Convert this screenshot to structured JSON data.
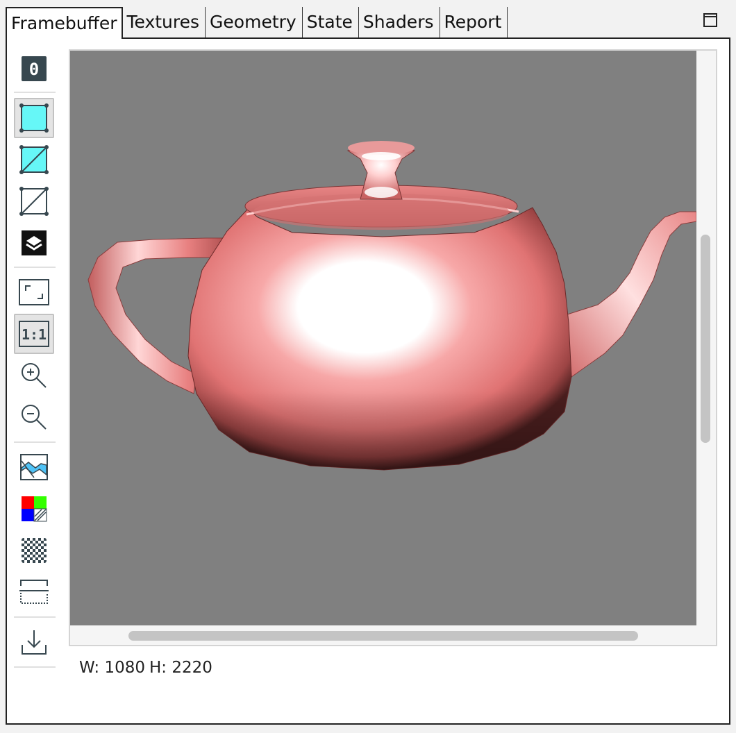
{
  "tabs": [
    {
      "label": "Framebuffer",
      "active": true
    },
    {
      "label": "Textures"
    },
    {
      "label": "Geometry"
    },
    {
      "label": "State"
    },
    {
      "label": "Shaders"
    },
    {
      "label": "Report"
    }
  ],
  "toolbar": {
    "attachment_label": "0",
    "zoom_actual_label": "1:1",
    "buttons": [
      {
        "icon": "attachment-index-icon",
        "label": "0"
      },
      {
        "icon": "render-rect-icon",
        "pressed": true
      },
      {
        "icon": "render-shaded-wireframe-icon"
      },
      {
        "icon": "render-wireframe-icon"
      },
      {
        "icon": "render-overdraw-icon"
      },
      {
        "icon": "fit-to-window-icon"
      },
      {
        "icon": "zoom-actual-icon",
        "label": "1:1",
        "pressed": true
      },
      {
        "icon": "zoom-in-icon"
      },
      {
        "icon": "zoom-out-icon"
      },
      {
        "icon": "histogram-icon"
      },
      {
        "icon": "color-channels-icon"
      },
      {
        "icon": "checkerboard-icon"
      },
      {
        "icon": "flip-vertical-icon"
      },
      {
        "icon": "save-image-icon"
      }
    ]
  },
  "status": {
    "width": "W: 1080",
    "height": "H: 2220"
  },
  "colors": {
    "canvas_background": "#808080",
    "teapot": "#e07a7a",
    "accent": "#5ff5f5"
  }
}
